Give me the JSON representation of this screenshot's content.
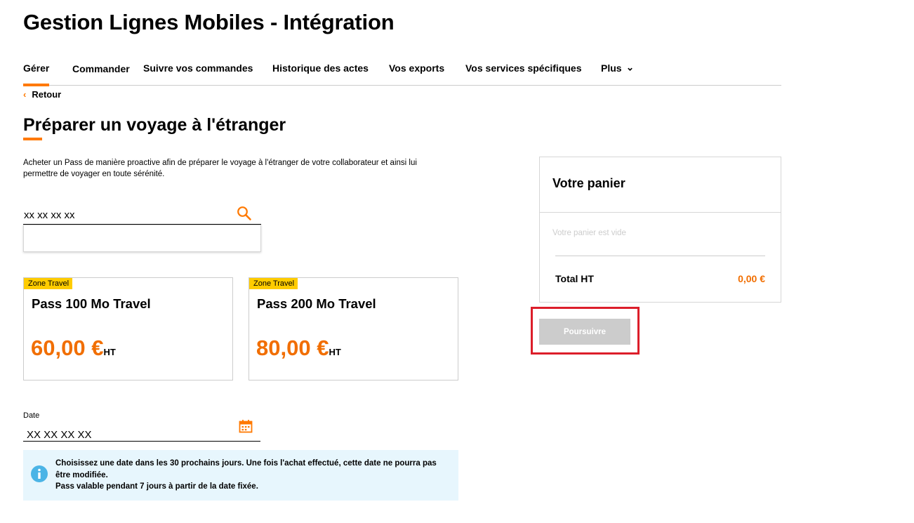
{
  "app": {
    "title": "Gestion Lignes Mobiles - Intégration"
  },
  "nav": {
    "items": [
      {
        "label": "Gérer",
        "active": true
      },
      {
        "label": "Commander"
      },
      {
        "label": "Suivre vos commandes"
      },
      {
        "label": "Historique des actes"
      },
      {
        "label": "Vos exports"
      },
      {
        "label": "Vos services spécifiques"
      },
      {
        "label": "Plus"
      }
    ],
    "back_label": "Retour"
  },
  "page": {
    "title": "Préparer un voyage à l'étranger",
    "description": "Acheter un Pass de manière proactive afin de préparer le voyage à l'étranger de votre collaborateur et ainsi lui permettre de voyager en toute sérénité."
  },
  "search": {
    "value": "xx xx xx xx",
    "icon": "search-icon"
  },
  "passes": [
    {
      "tag": "Zone Travel",
      "name": "Pass 100 Mo Travel",
      "price": "60,00 €",
      "unit": "HT"
    },
    {
      "tag": "Zone Travel",
      "name": "Pass 200 Mo Travel",
      "price": "80,00 €",
      "unit": "HT"
    }
  ],
  "date": {
    "label": "Date",
    "value": "XX XX XX XX",
    "icon": "calendar-icon"
  },
  "info": {
    "icon": "info-icon",
    "line1": "Choisissez une date dans les 30 prochains jours. Une fois l'achat effectué, cette date ne pourra pas être modifiée.",
    "line2": "Pass valable pendant 7 jours à partir de la date fixée."
  },
  "cart": {
    "title": "Votre panier",
    "empty_text": "Votre panier est vide",
    "total_label": "Total HT",
    "total_value": "0,00 €"
  },
  "actions": {
    "continue_label": "Poursuivre"
  },
  "colors": {
    "accent": "#ff7900",
    "price": "#f16e00",
    "tag": "#ffcc00",
    "highlight": "#dc1e2a",
    "info_bg": "#e7f6fd",
    "info_icon": "#4bb4e6",
    "disabled": "#cccccc"
  }
}
